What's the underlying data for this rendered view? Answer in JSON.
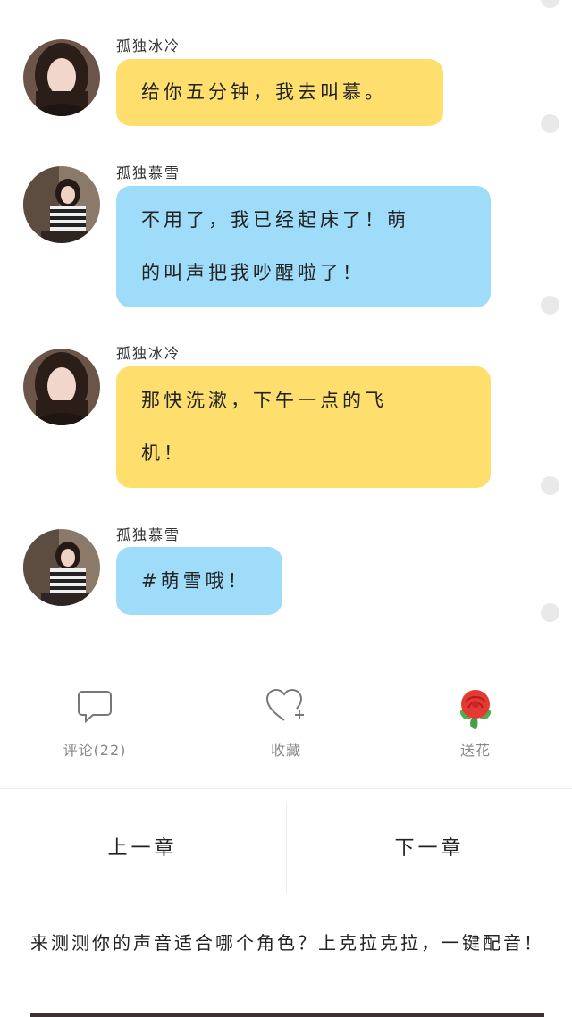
{
  "messages": [
    {
      "sender": "孤独冰冷",
      "lines": [
        "给你五分钟，我去叫慕。"
      ],
      "color": "yellow"
    },
    {
      "sender": "孤独慕雪",
      "lines": [
        "不用了，我已经起床了！萌",
        "的叫声把我吵醒啦了！"
      ],
      "color": "blue"
    },
    {
      "sender": "孤独冰冷",
      "lines": [
        "那快洗漱，下午一点的飞",
        "机！"
      ],
      "color": "yellow"
    },
    {
      "sender": "孤独慕雪",
      "lines": [
        "#萌雪哦！"
      ],
      "color": "blue"
    }
  ],
  "actions": {
    "comment_label": "评论(22)",
    "favorite_label": "收藏",
    "flower_label": "送花"
  },
  "chapter_nav": {
    "prev_label": "上一章",
    "next_label": "下一章"
  },
  "promo": {
    "text": "来测测你的声音适合哪个角色？上克拉克拉，一键配音！"
  },
  "colors": {
    "yellow_bubble": "#fedf6e",
    "blue_bubble": "#9fdcfa",
    "icons": [
      "speech-bubble-icon",
      "heart-plus-icon",
      "rose-icon"
    ]
  }
}
